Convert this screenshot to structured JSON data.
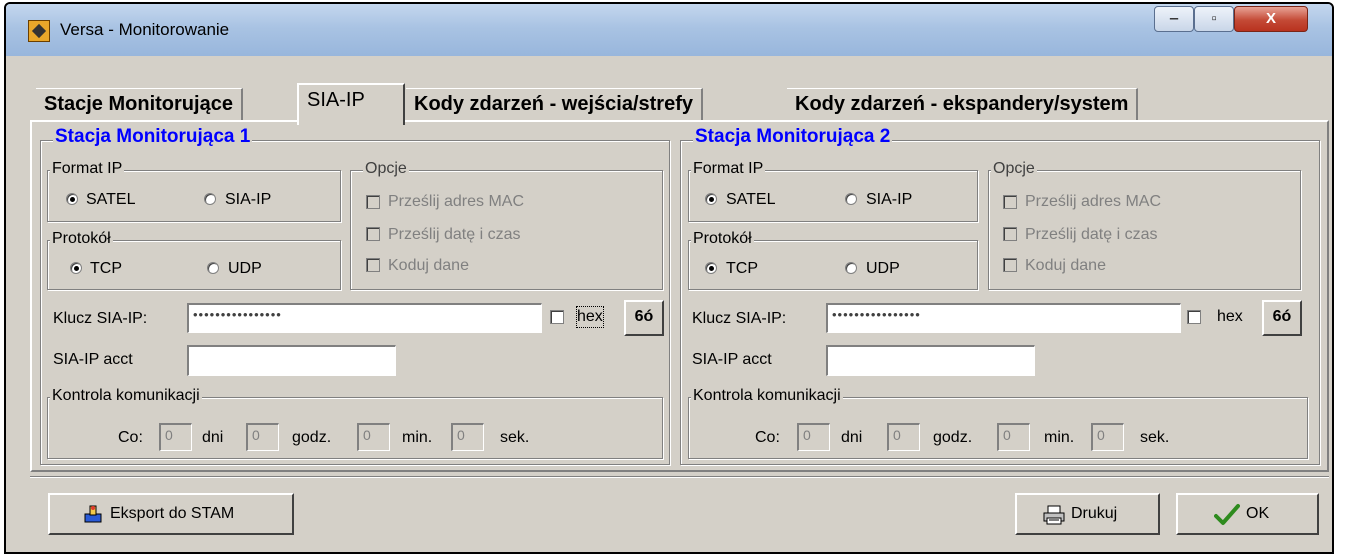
{
  "window": {
    "title": "Versa - Monitorowanie",
    "app_icon": "satel-app-icon",
    "controls": {
      "minimize": "‒",
      "maximize": "▫",
      "close": "X"
    }
  },
  "tabs": [
    {
      "label": "Stacje Monitorujące",
      "active": false
    },
    {
      "label": "SIA-IP",
      "active": true
    },
    {
      "label": "Kody zdarzeń - wejścia/strefy",
      "active": false
    },
    {
      "label": "Kody zdarzeń - ekspandery/system",
      "active": false
    }
  ],
  "stations": [
    {
      "title": "Stacja Monitorująca 1",
      "format": {
        "legend": "Format IP",
        "options": [
          "SATEL",
          "SIA-IP"
        ],
        "selected": "SATEL"
      },
      "protocol": {
        "legend": "Protokół",
        "options": [
          "TCP",
          "UDP"
        ],
        "selected": "TCP"
      },
      "options": {
        "legend": "Opcje",
        "items": [
          "Prześlij adres MAC",
          "Prześlij datę i czas",
          "Koduj dane"
        ]
      },
      "key_label": "Klucz SIA-IP:",
      "key_value": "••••••••••••••••",
      "hex_label": "hex",
      "hex_checked": false,
      "reveal_button": "6ó",
      "acct_label": "SIA-IP acct",
      "acct_value": "",
      "comm": {
        "legend": "Kontrola komunikacji",
        "co_label": "Co:",
        "days": "0",
        "days_label": "dni",
        "hours": "0",
        "hours_label": "godz.",
        "minutes": "0",
        "minutes_label": "min.",
        "seconds": "0",
        "seconds_label": "sek."
      }
    },
    {
      "title": "Stacja Monitorująca 2",
      "format": {
        "legend": "Format IP",
        "options": [
          "SATEL",
          "SIA-IP"
        ],
        "selected": "SATEL"
      },
      "protocol": {
        "legend": "Protokół",
        "options": [
          "TCP",
          "UDP"
        ],
        "selected": "TCP"
      },
      "options": {
        "legend": "Opcje",
        "items": [
          "Prześlij adres MAC",
          "Prześlij datę i czas",
          "Koduj dane"
        ]
      },
      "key_label": "Klucz SIA-IP:",
      "key_value": "••••••••••••••••",
      "hex_label": "hex",
      "hex_checked": false,
      "reveal_button": "6ó",
      "acct_label": "SIA-IP acct",
      "acct_value": "",
      "comm": {
        "legend": "Kontrola komunikacji",
        "co_label": "Co:",
        "days": "0",
        "days_label": "dni",
        "hours": "0",
        "hours_label": "godz.",
        "minutes": "0",
        "minutes_label": "min.",
        "seconds": "0",
        "seconds_label": "sek."
      }
    }
  ],
  "footer": {
    "export_button": "Eksport do STAM",
    "print_button": "Drukuj",
    "ok_button": "OK"
  },
  "colors": {
    "station_title": "#0000ff",
    "face": "#d4d0c8",
    "ok_check": "#2e8b1e"
  }
}
